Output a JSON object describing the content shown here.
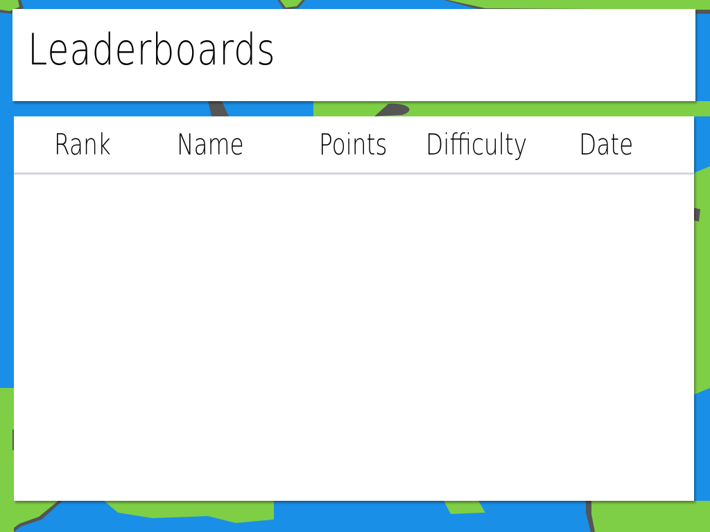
{
  "header": {
    "title": "Leaderboards"
  },
  "leaderboard": {
    "columns": [
      "Rank",
      "Name",
      "Points",
      "Difficulty",
      "Date"
    ],
    "rows": []
  },
  "colors": {
    "water": "#1a8fe8",
    "land": "#7ecf45",
    "shore": "#555555",
    "panel": "#ffffff",
    "divider": "#d2d6de"
  }
}
